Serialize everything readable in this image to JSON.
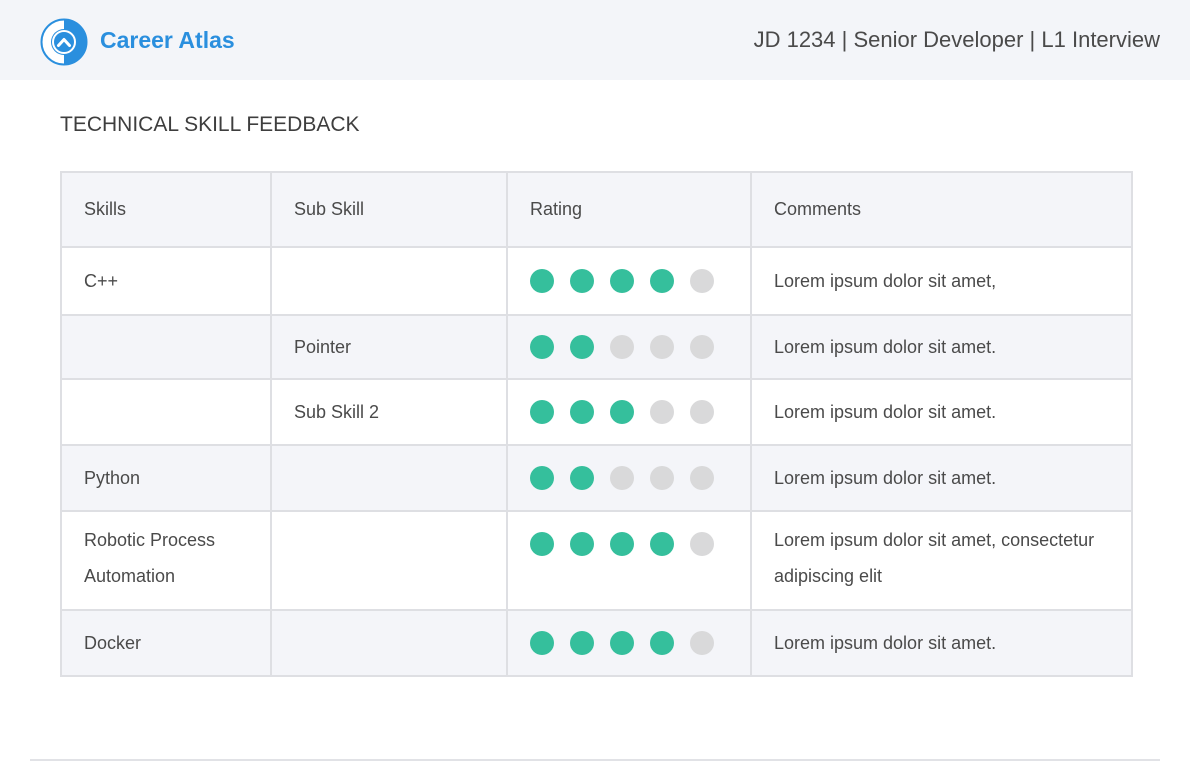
{
  "brand": {
    "name": "Career Atlas",
    "accent_color": "#2a8fde",
    "logo_icon": "chevron-up-circle-logo"
  },
  "header": {
    "info": "JD 1234 | Senior Developer | L1 Interview"
  },
  "section": {
    "title": "TECHNICAL SKILL FEEDBACK"
  },
  "table": {
    "columns": [
      "Skills",
      "Sub Skill",
      "Rating",
      "Comments"
    ],
    "rating_scale": 5,
    "rating_on_color": "#35bf9c",
    "rating_off_color": "#d9d9da",
    "rows": [
      {
        "skill": "C++",
        "sub_skill": "",
        "rating": 4,
        "comment": "Lorem ipsum dolor sit amet,"
      },
      {
        "skill": "",
        "sub_skill": "Pointer",
        "rating": 2,
        "comment": "Lorem ipsum dolor sit amet."
      },
      {
        "skill": "",
        "sub_skill": "Sub Skill 2",
        "rating": 3,
        "comment": "Lorem ipsum dolor sit amet."
      },
      {
        "skill": "Python",
        "sub_skill": "",
        "rating": 2,
        "comment": "Lorem ipsum dolor sit amet."
      },
      {
        "skill": "Robotic Process Automation",
        "sub_skill": "",
        "rating": 4,
        "comment": "Lorem ipsum dolor sit amet, consectetur adipiscing elit"
      },
      {
        "skill": "Docker",
        "sub_skill": "",
        "rating": 4,
        "comment": "Lorem ipsum dolor sit amet."
      }
    ]
  }
}
